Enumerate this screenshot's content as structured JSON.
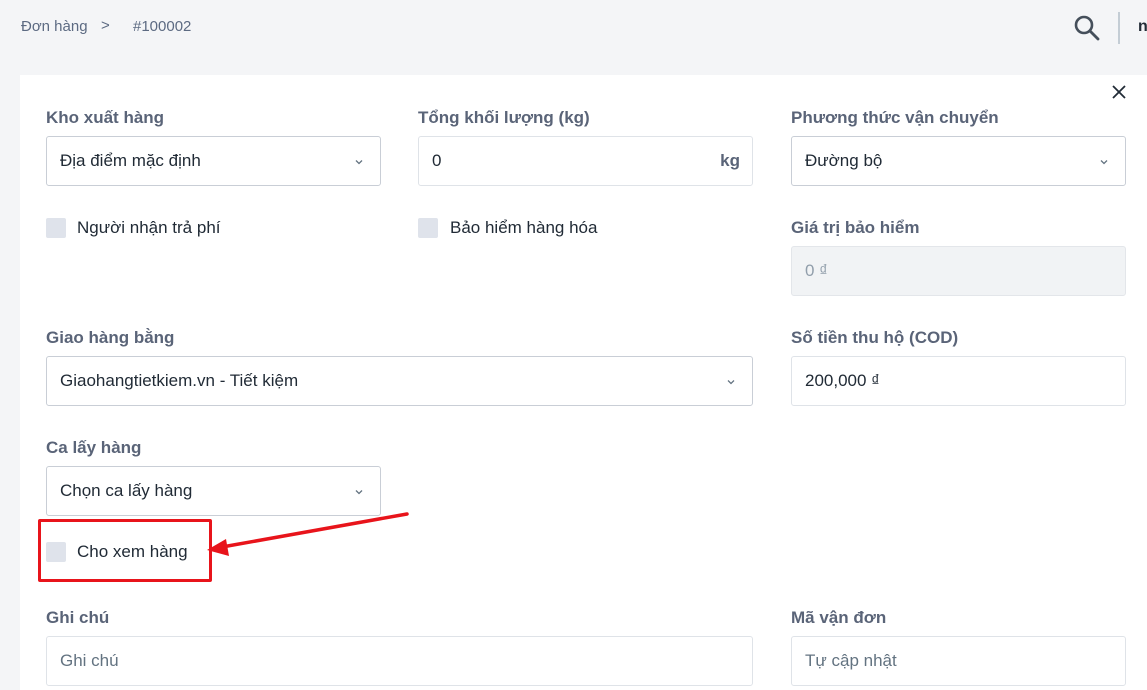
{
  "breadcrumb": {
    "orders": "Đơn hàng",
    "separator": ">",
    "order_id": "#100002"
  },
  "header": {
    "user_initial": "n"
  },
  "form": {
    "warehouse": {
      "label": "Kho xuất hàng",
      "value": "Địa điểm mặc định"
    },
    "weight": {
      "label": "Tổng khối lượng (kg)",
      "value": "0",
      "unit": "kg"
    },
    "shipping_method": {
      "label": "Phương thức vận chuyển",
      "value": "Đường bộ"
    },
    "receiver_pays": {
      "label": "Người nhận trả phí",
      "checked": false
    },
    "insurance": {
      "label": "Bảo hiểm hàng hóa",
      "checked": false
    },
    "insurance_value": {
      "label": "Giá trị bảo hiểm",
      "value": "0 ₫"
    },
    "carrier": {
      "label": "Giao hàng bằng",
      "value": "Giaohangtietkiem.vn - Tiết kiệm"
    },
    "cod": {
      "label": "Số tiền thu hộ (COD)",
      "value": "200,000 ₫"
    },
    "pickup_shift": {
      "label": "Ca lấy hàng",
      "value": "Chọn ca lấy hàng"
    },
    "allow_inspection": {
      "label": "Cho xem hàng",
      "checked": false
    },
    "note": {
      "label": "Ghi chú",
      "placeholder": "Ghi chú"
    },
    "tracking_code": {
      "label": "Mã vận đơn",
      "placeholder": "Tự cập nhật"
    }
  },
  "colors": {
    "highlight": "#e8141b",
    "label": "#5a6478",
    "checkbox": "#dfe3eb"
  },
  "icons": [
    "search-icon",
    "close-icon",
    "chevron-down-icon"
  ]
}
